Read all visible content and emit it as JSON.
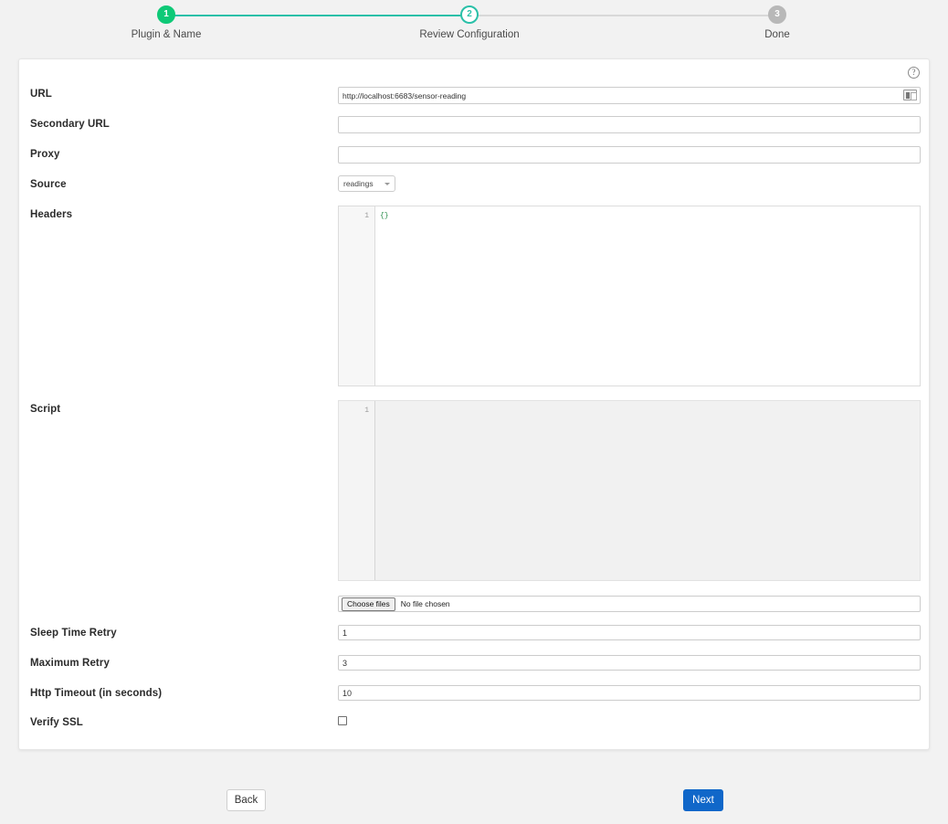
{
  "stepper": {
    "steps": [
      {
        "number": "1",
        "label": "Plugin & Name",
        "state": "done"
      },
      {
        "number": "2",
        "label": "Review Configuration",
        "state": "active"
      },
      {
        "number": "3",
        "label": "Done",
        "state": "todo"
      }
    ],
    "colors": {
      "done": "#0ec977",
      "active": "#2ac0a8",
      "todo": "#b8b8b8",
      "track": "#d8d8d8"
    }
  },
  "card": {
    "help_icon": "?",
    "help_icon_name": "help-circle-icon",
    "fields": {
      "url": {
        "label": "URL",
        "value": "http://localhost:6683/sensor-reading",
        "placeholder": "",
        "addon_icon": "panel-icon"
      },
      "secondary_url": {
        "label": "Secondary URL",
        "value": "",
        "placeholder": ""
      },
      "proxy": {
        "label": "Proxy",
        "value": "",
        "placeholder": ""
      },
      "source": {
        "label": "Source",
        "value": "readings",
        "options": [
          "readings"
        ]
      },
      "headers": {
        "label": "Headers",
        "line_number": "1",
        "content": "{}"
      },
      "script": {
        "label": "Script",
        "line_number": "1",
        "content": "",
        "disabled": true
      },
      "file": {
        "button_label": "Choose files",
        "status": "No file chosen"
      },
      "sleep_time_retry": {
        "label": "Sleep Time Retry",
        "value": "1"
      },
      "maximum_retry": {
        "label": "Maximum Retry",
        "value": "3"
      },
      "http_timeout": {
        "label": "Http Timeout (in seconds)",
        "value": "10"
      },
      "verify_ssl": {
        "label": "Verify SSL",
        "checked": false
      }
    }
  },
  "footer": {
    "back_label": "Back",
    "next_label": "Next",
    "next_color": "#1067c9"
  }
}
